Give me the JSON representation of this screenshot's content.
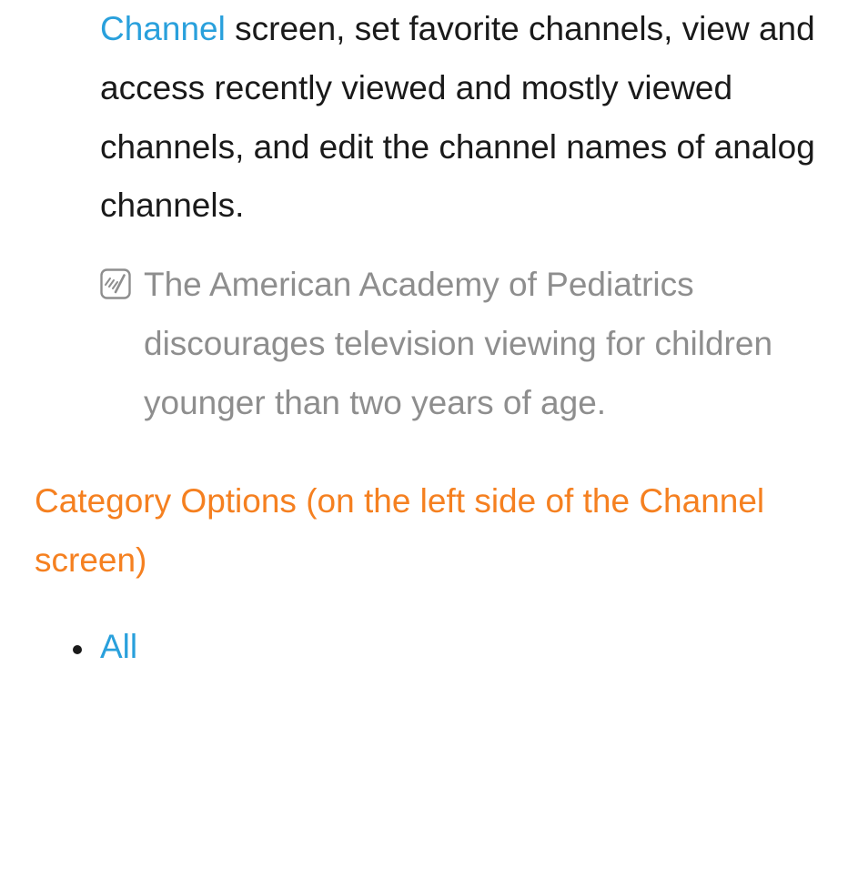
{
  "para1": {
    "link": "Channel",
    "rest": " screen, set favorite channels, view and access recently viewed and mostly viewed channels, and edit the channel names of analog channels."
  },
  "note": {
    "text": "The American Academy of Pediatrics discourages television viewing for children younger than two years of age."
  },
  "heading": "Category Options (on the left side of the Channel screen)",
  "list": {
    "items": [
      {
        "label": "All"
      }
    ]
  }
}
